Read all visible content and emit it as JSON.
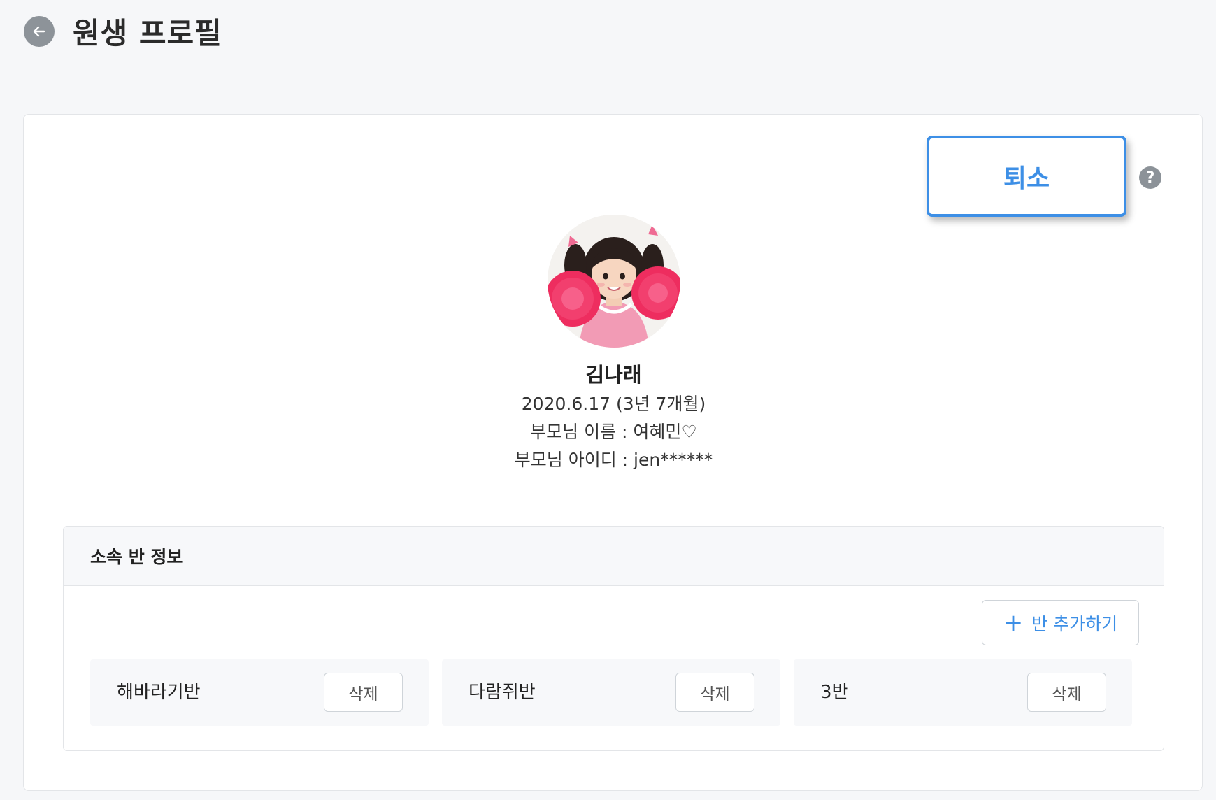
{
  "header": {
    "title": "원생 프로필",
    "back_icon": "arrow-left-icon"
  },
  "actions": {
    "discharge_label": "퇴소",
    "help_label": "?"
  },
  "profile": {
    "name": "김나래",
    "birth": "2020.6.17 (3년 7개월)",
    "parent_name": "부모님 이름 : 여혜민♡",
    "parent_id": "부모님 아이디 : jen******"
  },
  "class_section": {
    "title": "소속 반 정보",
    "add_button_label": "반 추가하기",
    "classes": [
      {
        "name": "해바라기반",
        "delete_label": "삭제"
      },
      {
        "name": "다람쥐반",
        "delete_label": "삭제"
      },
      {
        "name": "3반",
        "delete_label": "삭제"
      }
    ]
  },
  "colors": {
    "accent": "#3d8fe6",
    "page_bg": "#f6f7f9",
    "card_bg": "#ffffff",
    "muted_icon": "#8c9298"
  }
}
